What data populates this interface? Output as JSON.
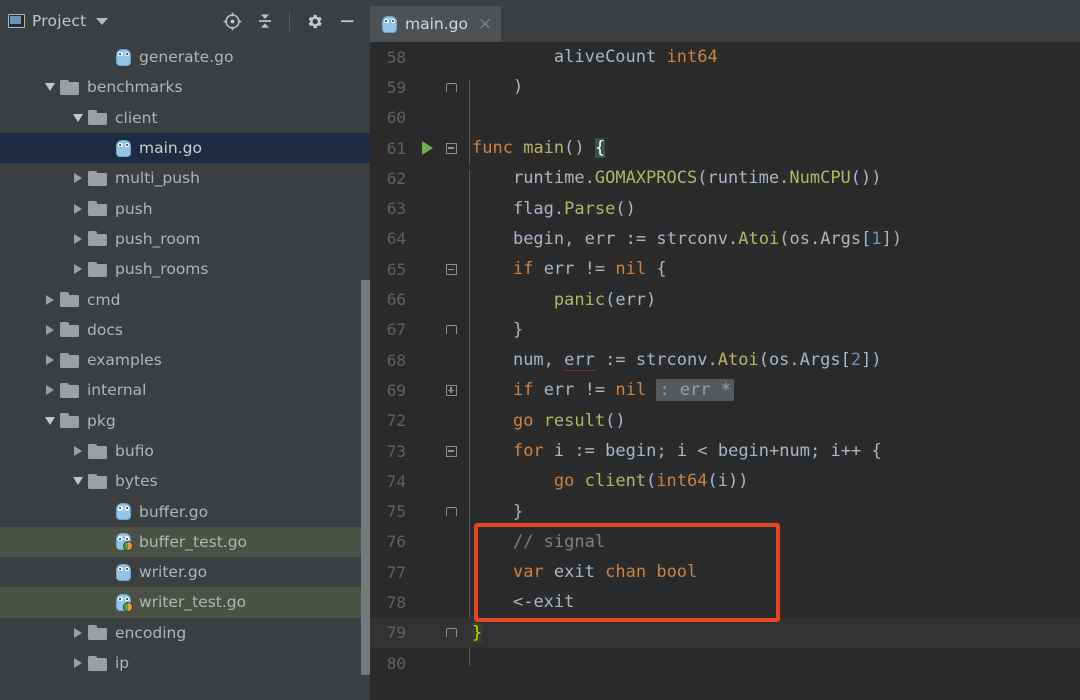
{
  "window": {
    "bg": "#3c3f41",
    "editor_bg": "#2b2b2b",
    "accent": "#4a88c7",
    "annotation_color": "#e8441f",
    "selection_color": "#1d2c42",
    "test_highlight_color": "#4b5144"
  },
  "tool_window": {
    "title": "Project",
    "icon": "project-panel-icon",
    "dropdown": "chevron-down-icon",
    "actions": [
      {
        "name": "locate-in-tree",
        "icon": "crosshair-icon"
      },
      {
        "name": "collapse-all",
        "icon": "collapse-all-icon"
      },
      {
        "name": "settings",
        "icon": "gear-icon"
      },
      {
        "name": "hide",
        "icon": "minimize-icon"
      }
    ]
  },
  "tabs": [
    {
      "label": "main.go",
      "icon": "go-file-icon",
      "close": "×",
      "active": true
    }
  ],
  "tree": [
    {
      "label": "generate.go",
      "indent": 3,
      "kind": "go-file",
      "twisty": "none",
      "state": "normal"
    },
    {
      "label": "benchmarks",
      "indent": 1,
      "kind": "folder",
      "twisty": "down",
      "state": "normal"
    },
    {
      "label": "client",
      "indent": 2,
      "kind": "folder",
      "twisty": "down",
      "state": "normal"
    },
    {
      "label": "main.go",
      "indent": 3,
      "kind": "go-file",
      "twisty": "none",
      "state": "selected"
    },
    {
      "label": "multi_push",
      "indent": 2,
      "kind": "folder",
      "twisty": "right",
      "state": "normal"
    },
    {
      "label": "push",
      "indent": 2,
      "kind": "folder",
      "twisty": "right",
      "state": "normal"
    },
    {
      "label": "push_room",
      "indent": 2,
      "kind": "folder",
      "twisty": "right",
      "state": "normal"
    },
    {
      "label": "push_rooms",
      "indent": 2,
      "kind": "folder",
      "twisty": "right",
      "state": "normal"
    },
    {
      "label": "cmd",
      "indent": 1,
      "kind": "folder",
      "twisty": "right",
      "state": "normal"
    },
    {
      "label": "docs",
      "indent": 1,
      "kind": "folder",
      "twisty": "right",
      "state": "normal"
    },
    {
      "label": "examples",
      "indent": 1,
      "kind": "folder",
      "twisty": "right",
      "state": "normal"
    },
    {
      "label": "internal",
      "indent": 1,
      "kind": "folder",
      "twisty": "right",
      "state": "normal"
    },
    {
      "label": "pkg",
      "indent": 1,
      "kind": "folder",
      "twisty": "down",
      "state": "normal"
    },
    {
      "label": "bufio",
      "indent": 2,
      "kind": "folder",
      "twisty": "right",
      "state": "normal"
    },
    {
      "label": "bytes",
      "indent": 2,
      "kind": "folder",
      "twisty": "down",
      "state": "normal"
    },
    {
      "label": "buffer.go",
      "indent": 3,
      "kind": "go-file",
      "twisty": "none",
      "state": "normal"
    },
    {
      "label": "buffer_test.go",
      "indent": 3,
      "kind": "go-test",
      "twisty": "none",
      "state": "highlight"
    },
    {
      "label": "writer.go",
      "indent": 3,
      "kind": "go-file",
      "twisty": "none",
      "state": "normal"
    },
    {
      "label": "writer_test.go",
      "indent": 3,
      "kind": "go-test",
      "twisty": "none",
      "state": "highlight"
    },
    {
      "label": "encoding",
      "indent": 2,
      "kind": "folder",
      "twisty": "right",
      "state": "normal"
    },
    {
      "label": "ip",
      "indent": 2,
      "kind": "folder",
      "twisty": "right",
      "state": "normal"
    }
  ],
  "editor": {
    "language": "go",
    "lines": [
      {
        "num": "58",
        "fold": "none",
        "run": false,
        "text": "        aliveCount int64"
      },
      {
        "num": "59",
        "fold": "end",
        "run": false,
        "text": "    )"
      },
      {
        "num": "60",
        "fold": "none",
        "run": false,
        "text": ""
      },
      {
        "num": "61",
        "fold": "open",
        "run": true,
        "text": "func main() {"
      },
      {
        "num": "62",
        "fold": "none",
        "run": false,
        "text": "    runtime.GOMAXPROCS(runtime.NumCPU())"
      },
      {
        "num": "63",
        "fold": "none",
        "run": false,
        "text": "    flag.Parse()"
      },
      {
        "num": "64",
        "fold": "none",
        "run": false,
        "text": "    begin, err := strconv.Atoi(os.Args[1])"
      },
      {
        "num": "65",
        "fold": "open",
        "run": false,
        "text": "    if err != nil {"
      },
      {
        "num": "66",
        "fold": "none",
        "run": false,
        "text": "        panic(err)"
      },
      {
        "num": "67",
        "fold": "end",
        "run": false,
        "text": "    }"
      },
      {
        "num": "68",
        "fold": "none",
        "run": false,
        "text": "    num, err := strconv.Atoi(os.Args[2])"
      },
      {
        "num": "69",
        "fold": "plus",
        "run": false,
        "text": "    if err != nil : err *"
      },
      {
        "num": "72",
        "fold": "none",
        "run": false,
        "text": "    go result()"
      },
      {
        "num": "73",
        "fold": "open",
        "run": false,
        "text": "    for i := begin; i < begin+num; i++ {"
      },
      {
        "num": "74",
        "fold": "none",
        "run": false,
        "text": "        go client(int64(i))"
      },
      {
        "num": "75",
        "fold": "end",
        "run": false,
        "text": "    }"
      },
      {
        "num": "76",
        "fold": "none",
        "run": false,
        "text": "    // signal"
      },
      {
        "num": "77",
        "fold": "none",
        "run": false,
        "text": "    var exit chan bool"
      },
      {
        "num": "78",
        "fold": "none",
        "run": false,
        "text": "    <-exit"
      },
      {
        "num": "79",
        "fold": "end",
        "run": false,
        "text": "}"
      },
      {
        "num": "80",
        "fold": "none",
        "run": false,
        "text": ""
      }
    ]
  },
  "annotation": {
    "label": "signal-block-highlight",
    "covers_lines": [
      "76",
      "77",
      "78"
    ]
  }
}
